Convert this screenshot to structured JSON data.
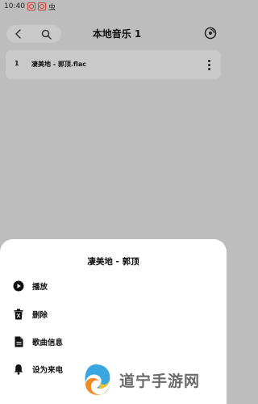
{
  "status_bar": {
    "time": "10:40",
    "app_glyph": "虫"
  },
  "header": {
    "title": "本地音乐 1"
  },
  "song": {
    "index": "1",
    "name": "凄美地 - 郭顶.flac"
  },
  "sheet": {
    "title": "凄美地 - 郭顶",
    "items": [
      {
        "label": "播放",
        "icon": "play-circle-icon"
      },
      {
        "label": "删除",
        "icon": "trash-icon"
      },
      {
        "label": "歌曲信息",
        "icon": "document-icon"
      },
      {
        "label": "设为来电",
        "icon": "bell-icon"
      }
    ]
  },
  "watermark": {
    "text": "道宁手游网"
  },
  "colors": {
    "overlay": "#bdbdbd",
    "sheet": "#ffffff",
    "notification_red": "#d23a3a"
  }
}
